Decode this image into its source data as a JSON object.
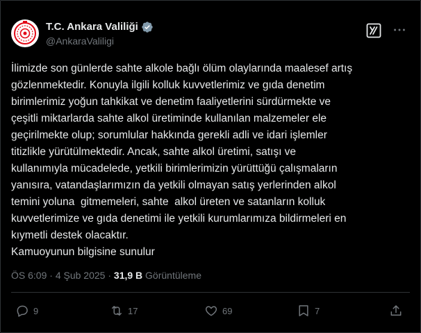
{
  "author": {
    "name": "T.C. Ankara Valiliği",
    "handle": "@AnkaraValiligi"
  },
  "tweet": {
    "lines": [
      "İlimizde son günlerde sahte alkole bağlı ölüm olaylarında maalesef artış",
      "gözlenmektedir. Konuyla ilgili kolluk kuvvetlerimiz ve gıda denetim",
      "birimlerimiz yoğun tahkikat ve denetim faaliyetlerini sürdürmekte ve",
      "çeşitli miktarlarda sahte alkol üretiminde kullanılan malzemeler ele",
      "geçirilmekte olup; sorumlular hakkında gerekli adli ve idari işlemler",
      "titizlikle yürütülmektedir. Ancak, sahte alkol üretimi, satışı ve",
      "kullanımıyla mücadelede, yetkili birimlerimizin yürüttüğü çalışmaların",
      "yanısıra, vatandaşlarımızın da yetkili olmayan satış yerlerinden alkol",
      "temini yoluna  gitmemeleri, sahte  alkol üreten ve satanların kolluk",
      "kuvvetlerimize ve gıda denetimi ile yetkili kurumlarımıza bildirmeleri en",
      "kıymetli destek olacaktır.",
      "Kamuoyunun bilgisine sunulur"
    ]
  },
  "meta": {
    "time": "ÖS 6:09",
    "separator": "·",
    "date": "4 Şub 2025",
    "views_count": "31,9 B",
    "views_label": "Görüntüleme"
  },
  "actions": {
    "replies": "9",
    "reposts": "17",
    "likes": "69",
    "bookmarks": "7"
  },
  "icons": {
    "avatar": "ankara-governorship-logo",
    "verified": "gray-verified-badge",
    "grok": "grok-icon",
    "more": "more-icon",
    "reply": "reply-icon",
    "repost": "repost-icon",
    "like": "heart-icon",
    "bookmark": "bookmark-icon",
    "share": "share-icon"
  },
  "colors": {
    "background": "#000000",
    "text": "#e7e9ea",
    "muted": "#71767b",
    "border": "#2f3336",
    "logo_red": "#e30a17",
    "verified_gray": "#829aab"
  }
}
